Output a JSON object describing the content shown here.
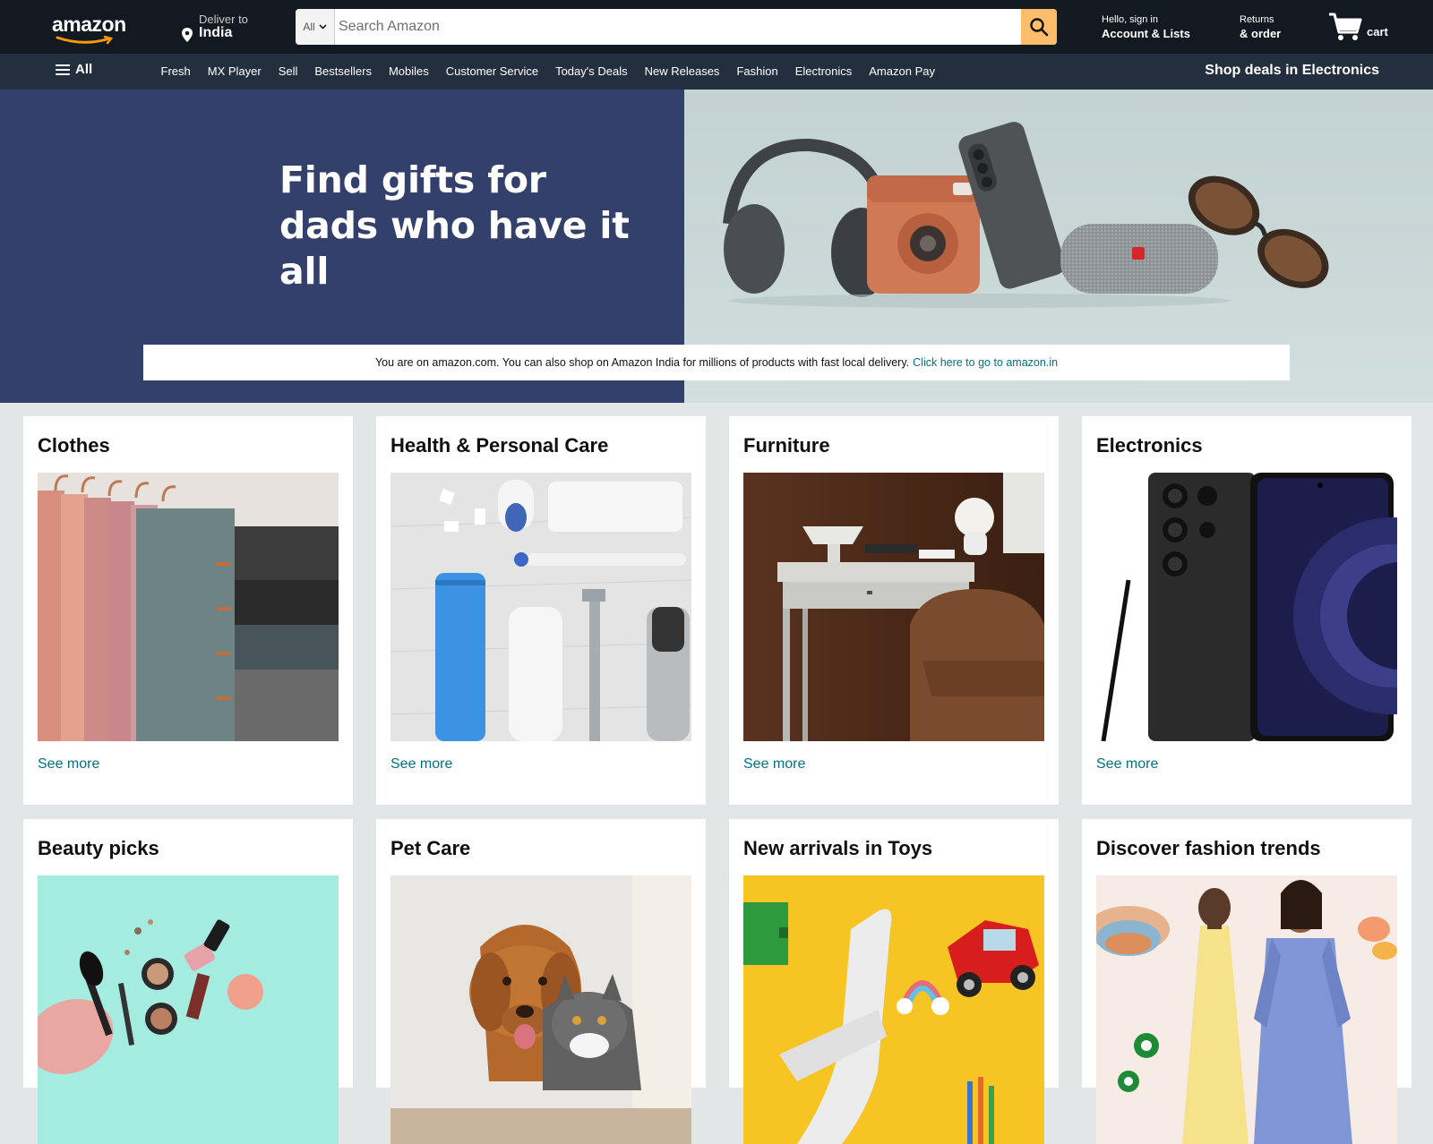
{
  "header": {
    "logo_text": "amazon",
    "deliver_line1": "Deliver to",
    "deliver_line2": "India",
    "search_category": "All",
    "search_placeholder": "Search Amazon",
    "account_line1": "Hello, sign in",
    "account_line2": "Account & Lists",
    "returns_line1": "Returns",
    "returns_line2": "& order",
    "cart_label": "cart"
  },
  "subnav": {
    "all_label": "All",
    "links": [
      "Fresh",
      "MX Player",
      "Sell",
      "Bestsellers",
      "Mobiles",
      "Customer Service",
      "Today's Deals",
      "New Releases",
      "Fashion",
      "Electronics",
      "Amazon Pay"
    ],
    "promo": "Shop deals in Electronics"
  },
  "hero": {
    "title_line1": "Find gifts for",
    "title_line2": "dads who have it all",
    "notice_text": "You are on amazon.com. You can also shop on Amazon India for millions of products with fast local delivery.",
    "notice_link": "Click here to go to amazon.in"
  },
  "cards": [
    {
      "title": "Clothes",
      "link": "See more"
    },
    {
      "title": "Health & Personal Care",
      "link": "See more"
    },
    {
      "title": "Furniture",
      "link": "See more"
    },
    {
      "title": "Electronics",
      "link": "See more"
    },
    {
      "title": "Beauty picks"
    },
    {
      "title": "Pet Care"
    },
    {
      "title": "New arrivals in Toys"
    },
    {
      "title": "Discover fashion trends"
    }
  ],
  "colors": {
    "header_bg": "#131921",
    "subnav_bg": "#232f3e",
    "search_button": "#febd69",
    "link": "#007185",
    "hero_left": "#33406b",
    "page_bg": "#e3e6e6"
  }
}
